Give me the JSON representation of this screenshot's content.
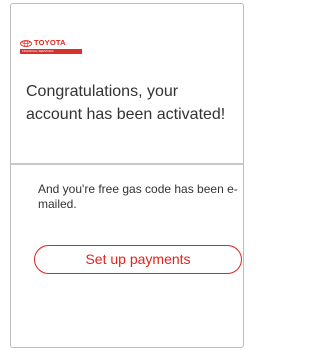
{
  "brand": {
    "name": "TOYOTA",
    "subtitle": "FINANCIAL SERVICES",
    "accent_color": "#e2231a"
  },
  "confirmation": {
    "headline": "Congratulations, your account has been activated!",
    "message": "And you're free gas code has been e-mailed."
  },
  "actions": {
    "setup_payments_label": "Set up payments"
  }
}
